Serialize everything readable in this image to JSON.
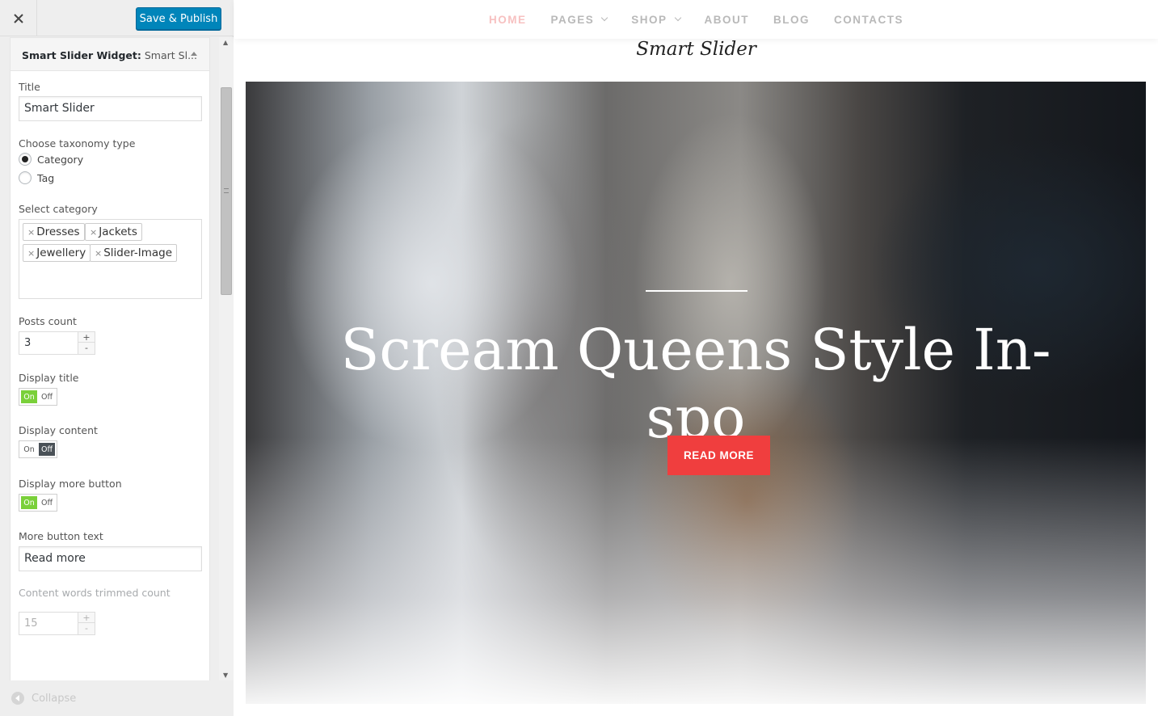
{
  "header": {
    "publish_label": "Save & Publish"
  },
  "widget": {
    "title_bold": "Smart Slider Widget:",
    "title_sub": "Smart Sl...",
    "title_label": "Title",
    "title_value": "Smart Slider",
    "taxonomy_label": "Choose taxonomy type",
    "taxonomy_options": [
      {
        "label": "Category",
        "selected": true
      },
      {
        "label": "Tag",
        "selected": false
      }
    ],
    "category_label": "Select category",
    "categories": [
      "Dresses",
      "Jackets",
      "Jewellery",
      "Slider-Image"
    ],
    "tag_remove_glyph": "×",
    "posts_count_label": "Posts count",
    "posts_count": "3",
    "display_title_label": "Display title",
    "display_content_label": "Display content",
    "display_more_label": "Display more button",
    "toggle_on": "On",
    "toggle_off": "Off",
    "display_title": true,
    "display_content": false,
    "display_more": true,
    "more_text_label": "More button text",
    "more_text_value": "Read more",
    "trim_label": "Content words trimmed count",
    "trim_value": "15",
    "slider_level": 0.25
  },
  "footer": {
    "collapse_label": "Collapse"
  },
  "nav": {
    "items": [
      {
        "label": "Home",
        "active": true,
        "dropdown": false
      },
      {
        "label": "Pages",
        "active": false,
        "dropdown": true
      },
      {
        "label": "Shop",
        "active": false,
        "dropdown": true
      },
      {
        "label": "About",
        "active": false,
        "dropdown": false
      },
      {
        "label": "Blog",
        "active": false,
        "dropdown": false
      },
      {
        "label": "Contacts",
        "active": false,
        "dropdown": false
      }
    ]
  },
  "preview": {
    "widget_heading": "Smart Slider",
    "slide_title": "Scream Queens Style In-spo",
    "read_more_label": "Read more"
  },
  "colors": {
    "publish": "#0085ba",
    "toggle_on": "#7ad03a",
    "toggle_off": "#4a5157",
    "read_more": "#f03e3e",
    "nav_active": "#f7c1c1"
  }
}
